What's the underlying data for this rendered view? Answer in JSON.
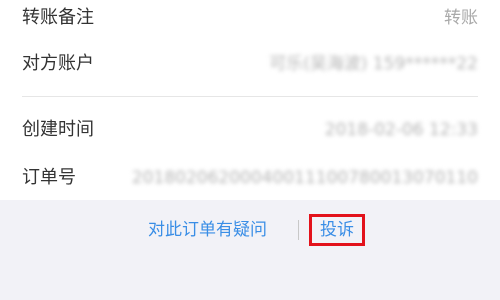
{
  "details": {
    "remark_label": "转账备注",
    "remark_value": "转账",
    "account_label": "对方账户",
    "account_value": "可乐(吴海波) 159******22",
    "created_label": "创建时间",
    "created_value": "2018-02-06 12:33",
    "order_label": "订单号",
    "order_value": "20180206200040011100780013070110"
  },
  "footer": {
    "question_label": "对此订单有疑问",
    "complain_label": "投诉"
  },
  "colors": {
    "link": "#3a8ee6",
    "highlight_border": "#e3121b",
    "label": "#333333",
    "value": "#a9a9a9"
  }
}
